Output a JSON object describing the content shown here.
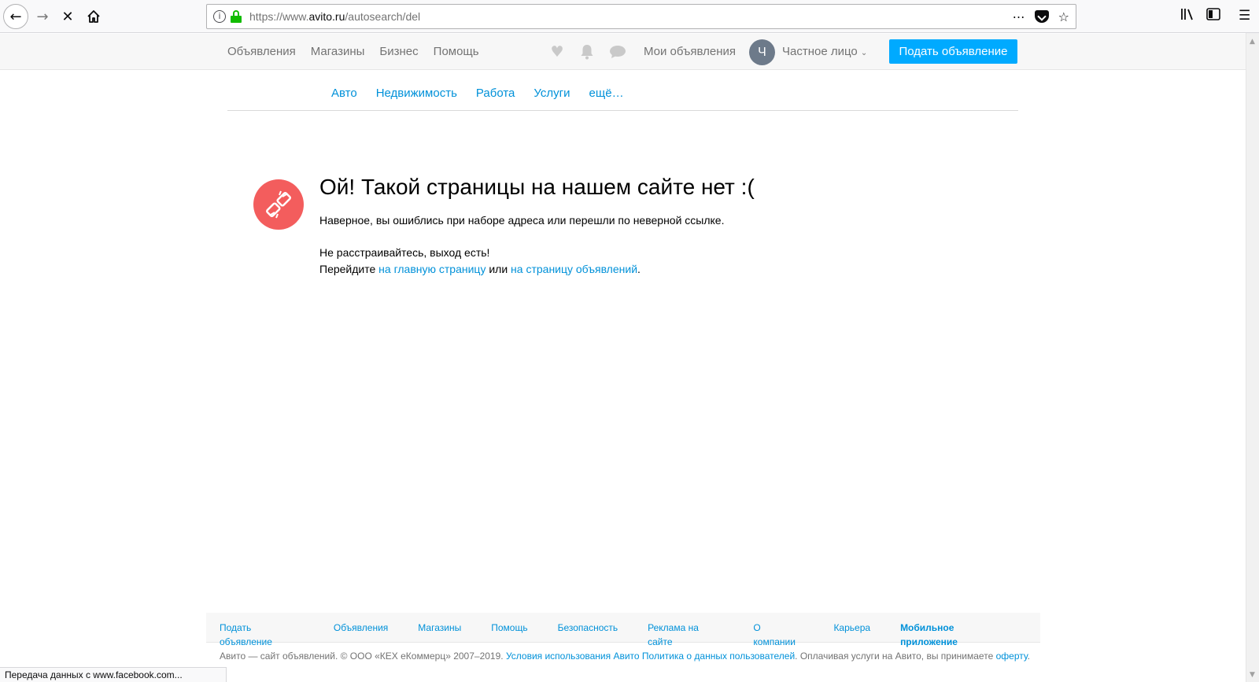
{
  "browser": {
    "url_scheme": "https://www.",
    "url_host": "avito.ru",
    "url_path": "/autosearch/del",
    "icons": [
      "back-icon",
      "forward-icon",
      "stop-icon",
      "home-icon",
      "info-icon",
      "lock-icon",
      "more-icon",
      "pocket-icon",
      "bookmark-star-icon",
      "library-icon",
      "sidebar-icon",
      "menu-icon"
    ]
  },
  "header": {
    "links": [
      "Объявления",
      "Магазины",
      "Бизнес",
      "Помощь"
    ],
    "my_ads": "Мои объявления",
    "avatar_letter": "Ч",
    "user_name": "Частное лицо",
    "post_button": "Подать объявление"
  },
  "categories": [
    "Авто",
    "Недвижимость",
    "Работа",
    "Услуги",
    "ещё…"
  ],
  "error": {
    "title": "Ой! Такой страницы на нашем сайте нет :(",
    "line1": "Наверное, вы ошиблись при наборе адреса или перешли по неверной ссылке.",
    "line2": "Не расстраивайтесь, выход есть!",
    "line3_prefix": "Перейдите ",
    "link_home": "на главную страницу",
    "line3_mid": " или ",
    "link_ads": "на страницу объявлений",
    "line3_suffix": ".",
    "icon_color": "#f35d5d"
  },
  "footer": {
    "links": [
      "Подать объявление",
      "Объявления",
      "Магазины",
      "Помощь",
      "Безопасность",
      "Реклама на сайте",
      "О компании",
      "Карьера",
      "Мобильное приложение"
    ],
    "copyright_prefix": "Авито — сайт объявлений. © ООО «КЕХ еКоммерц» 2007–2019. ",
    "terms_link": "Условия использования Авито",
    "policy_link": "Политика о данных пользователей",
    "copyright_suffix": ". Оплачивая услуги на Авито, вы принимаете",
    "offer_link": "оферту",
    "offer_suffix": "."
  },
  "status": "Передача данных с www.facebook.com...",
  "colors": {
    "accent": "#00aaff",
    "link": "#0091d9",
    "secure": "#12bc00"
  }
}
